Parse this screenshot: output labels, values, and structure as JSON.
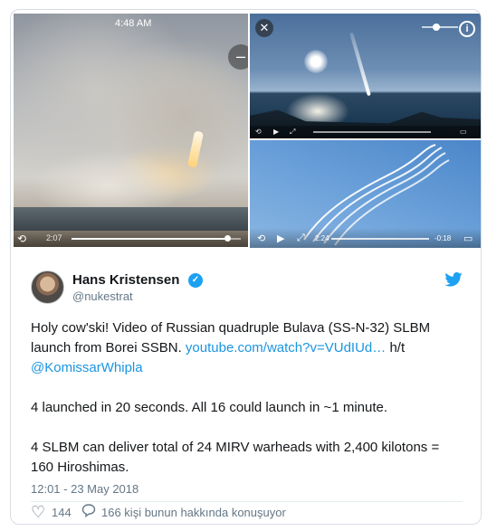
{
  "media": {
    "left_video": {
      "status_time": "4:48 AM",
      "elapsed": "2:07",
      "progress": 0.92
    },
    "top_right_video": {
      "close_icon": "close-icon",
      "info_icon": "info-icon",
      "volume_level": 0.4
    },
    "bottom_right_video": {
      "current_time": "2:24",
      "remaining": "-0:18"
    }
  },
  "tweet": {
    "author": {
      "display_name": "Hans Kristensen",
      "handle": "@nukestrat",
      "verified": true
    },
    "text": {
      "line1_prefix": "Holy cow'ski! Video of Russian quadruple Bulava (SS-N-32) SLBM launch from Borei SSBN. ",
      "link": "youtube.com/watch?v=VUdIUd…",
      "ht": " h/t",
      "mention": "@KomissarWhipla",
      "para2": "4 launched in 20 seconds. All 16 could launch in ~1 minute.",
      "para3": "4 SLBM can deliver total of 24 MIRV warheads with 2,400 kilotons = 160 Hiroshimas."
    },
    "timestamp": "12:01 - 23 May 2018",
    "likes": "144",
    "reply_text": "166 kişi bunun hakkında konuşuyor"
  },
  "colors": {
    "accent": "#1da1f2",
    "link": "#1b95e0",
    "text": "#14171a",
    "muted": "#657786"
  }
}
